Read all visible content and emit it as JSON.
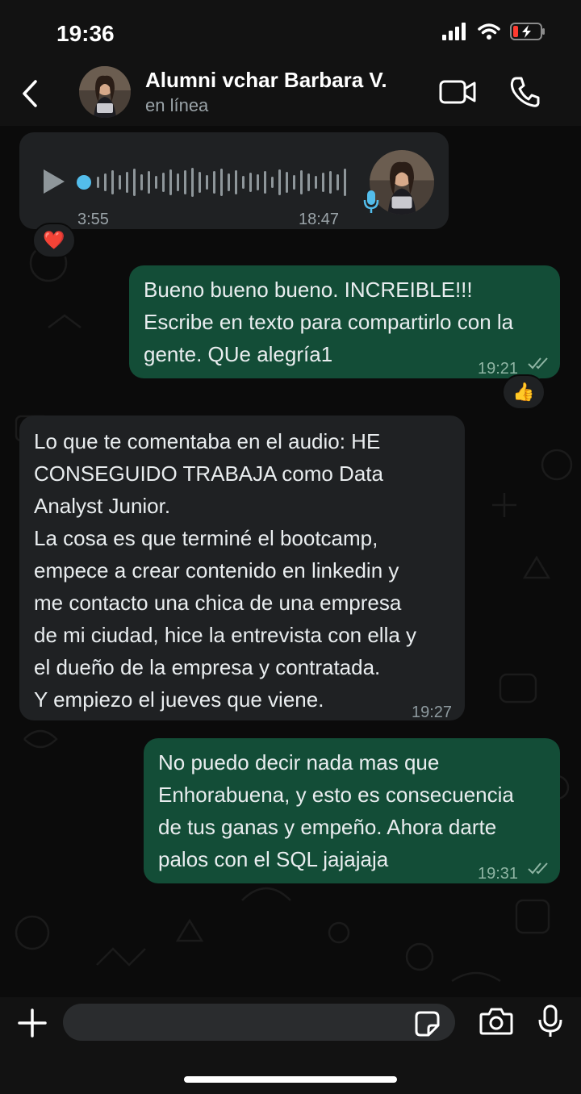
{
  "status_bar": {
    "time": "19:36"
  },
  "header": {
    "contact_name": "Alumni vchar Barbara V.",
    "contact_status": "en línea"
  },
  "messages": [
    {
      "type": "voice",
      "direction": "incoming",
      "duration": "3:55",
      "time": "18:47",
      "reaction": "❤️"
    },
    {
      "type": "text",
      "direction": "outgoing",
      "lines": [
        "Bueno bueno bueno. INCREIBLE!!!",
        "Escribe en texto para compartirlo con la",
        "gente. QUe alegría1"
      ],
      "time": "19:21",
      "reaction": "👍"
    },
    {
      "type": "text",
      "direction": "incoming",
      "lines": [
        "Lo que te comentaba en el audio: HE",
        "CONSEGUIDO TRABAJA como Data",
        "Analyst Junior.",
        "La cosa es que terminé el bootcamp,",
        "empece a crear contenido en linkedin y",
        "me contacto una chica de una empresa",
        "de mi ciudad, hice la entrevista con ella y",
        "el dueño de la empresa y contratada.",
        "Y empiezo el jueves que viene."
      ],
      "time": "19:27"
    },
    {
      "type": "text",
      "direction": "outgoing",
      "lines": [
        "No puedo decir nada mas que",
        "Enhorabuena, y esto es consecuencia",
        "de tus ganas y empeño. Ahora darte",
        "palos con el SQL jajajaja"
      ],
      "time": "19:31"
    }
  ],
  "colors": {
    "incoming_bubble": "#1f2123",
    "outgoing_bubble": "#134d37",
    "accent": "#53bdeb",
    "background": "#0b0b0b"
  },
  "icons": [
    "back-icon",
    "video-call-icon",
    "phone-icon",
    "play-icon",
    "mic-icon",
    "plus-icon",
    "sticker-icon",
    "camera-icon"
  ]
}
